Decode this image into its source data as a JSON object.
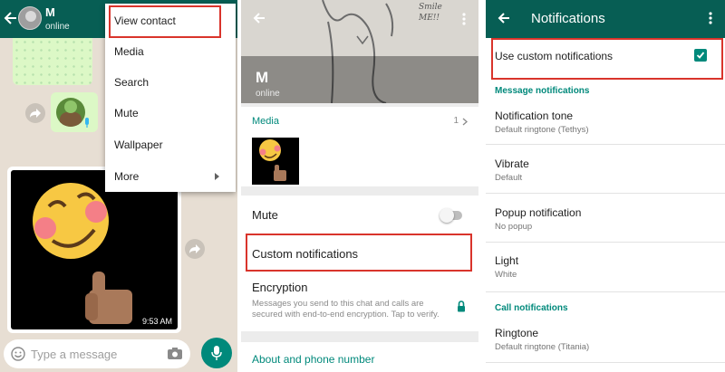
{
  "chat": {
    "contact_name": "M",
    "contact_status": "online",
    "image_timestamp": "9:53 AM",
    "input_placeholder": "Type a message",
    "menu": {
      "items": [
        {
          "label": "View contact"
        },
        {
          "label": "Media"
        },
        {
          "label": "Search"
        },
        {
          "label": "Mute"
        },
        {
          "label": "Wallpaper"
        },
        {
          "label": "More"
        }
      ]
    }
  },
  "contact": {
    "name": "M",
    "status": "online",
    "media_label": "Media",
    "media_count": "1",
    "mute_label": "Mute",
    "mute_on": false,
    "custom_notifications_label": "Custom notifications",
    "encryption_title": "Encryption",
    "encryption_text": "Messages you send to this chat and calls are secured with end-to-end encryption. Tap to verify.",
    "about_label": "About and phone number",
    "header_art_text": "Smile ME!!"
  },
  "notifications": {
    "title": "Notifications",
    "use_custom_label": "Use custom notifications",
    "use_custom_checked": true,
    "message_section": "Message notifications",
    "tone_title": "Notification tone",
    "tone_value": "Default ringtone (Tethys)",
    "vibrate_title": "Vibrate",
    "vibrate_value": "Default",
    "popup_title": "Popup notification",
    "popup_value": "No popup",
    "light_title": "Light",
    "light_value": "White",
    "call_section": "Call notifications",
    "ringtone_title": "Ringtone",
    "ringtone_value": "Default ringtone (Titania)"
  },
  "colors": {
    "primary": "#075e54",
    "accent": "#00897b",
    "highlight": "#d9342b",
    "bubble": "#dcf8c6"
  },
  "icons": [
    "back-arrow-icon",
    "kebab-menu-icon",
    "forward-icon",
    "mic-icon",
    "emoji-icon",
    "camera-icon",
    "lock-icon",
    "chevron-right-icon",
    "checkmark-icon",
    "submenu-arrow-icon"
  ]
}
